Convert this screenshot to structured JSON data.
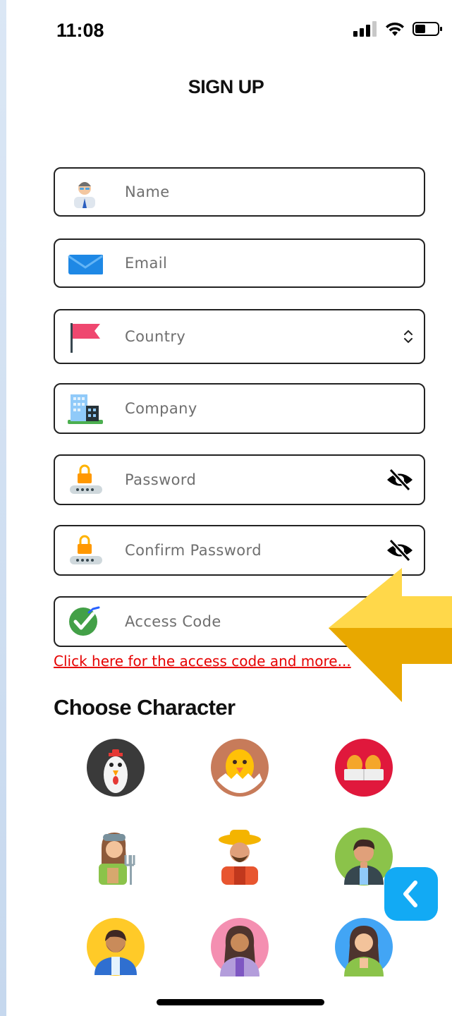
{
  "status_bar": {
    "time": "11:08",
    "icons": [
      "cellular-signal-icon",
      "wifi-icon",
      "battery-icon"
    ]
  },
  "page": {
    "title": "SIGN UP"
  },
  "form": {
    "fields": [
      {
        "placeholder": "Name",
        "icon": "user-avatar-icon"
      },
      {
        "placeholder": "Email",
        "icon": "envelope-icon"
      },
      {
        "placeholder": "Country",
        "icon": "flag-icon",
        "control": "updown-chevron-icon"
      },
      {
        "placeholder": "Company",
        "icon": "building-icon"
      },
      {
        "placeholder": "Password",
        "icon": "padlock-icon",
        "control": "eye-slash-icon"
      },
      {
        "placeholder": "Confirm Password",
        "icon": "padlock-icon",
        "control": "eye-slash-icon"
      },
      {
        "placeholder": "Access Code",
        "icon": "checkmark-badge-icon"
      }
    ],
    "access_code_link": "Click here for the access code and more..."
  },
  "characters": {
    "heading": "Choose Character",
    "options": [
      "rooster-avatar",
      "chick-avatar",
      "eggs-avatar",
      "female-farmer-avatar",
      "male-farmer-avatar",
      "man-avatar",
      "bearded-man-avatar",
      "woman-avatar",
      "woman-blue-avatar"
    ]
  },
  "colors": {
    "accent": "#12aaf4",
    "link": "#e60000",
    "arrow": "#f6c000"
  }
}
